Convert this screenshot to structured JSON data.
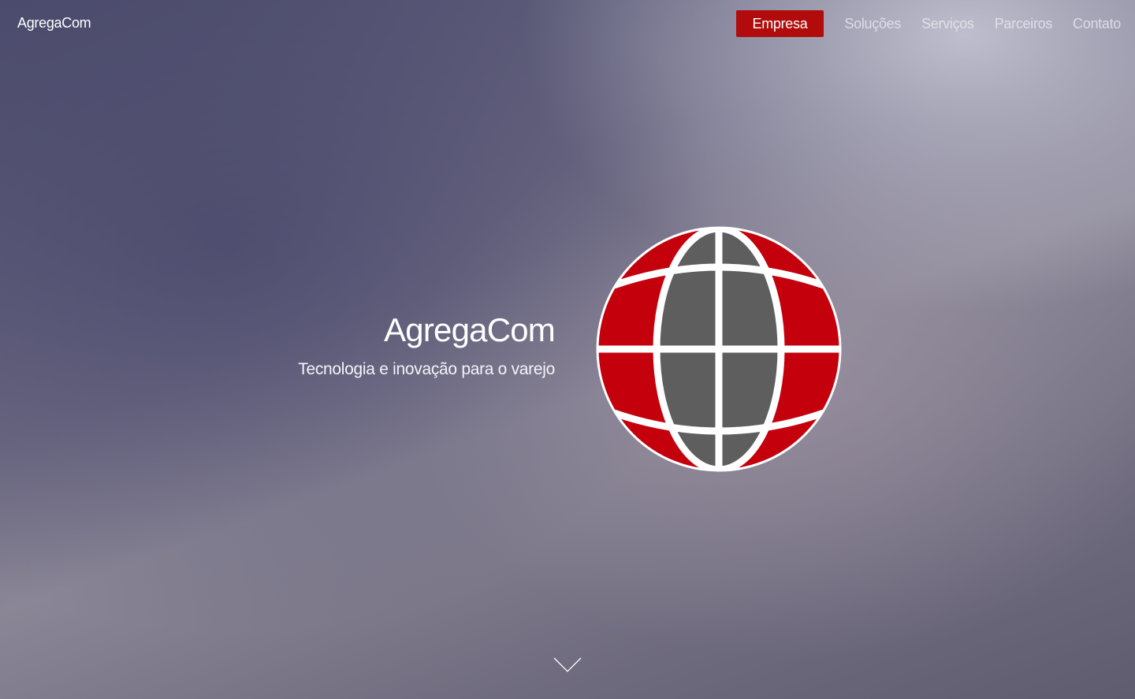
{
  "header": {
    "brand": "AgregaCom"
  },
  "nav": {
    "items": [
      {
        "label": "Empresa",
        "active": true
      },
      {
        "label": "Soluções",
        "active": false
      },
      {
        "label": "Serviços",
        "active": false
      },
      {
        "label": "Parceiros",
        "active": false
      },
      {
        "label": "Contato",
        "active": false
      }
    ]
  },
  "hero": {
    "title": "AgregaCom",
    "subtitle": "Tecnologia e inovação para o varejo",
    "logo_icon": "globe-icon",
    "scroll_icon": "chevron-down-icon"
  },
  "colors": {
    "accent": "#b10b0b",
    "globe_red": "#c4000d",
    "globe_gray": "#5e5e5e",
    "globe_lines": "#ffffff"
  }
}
